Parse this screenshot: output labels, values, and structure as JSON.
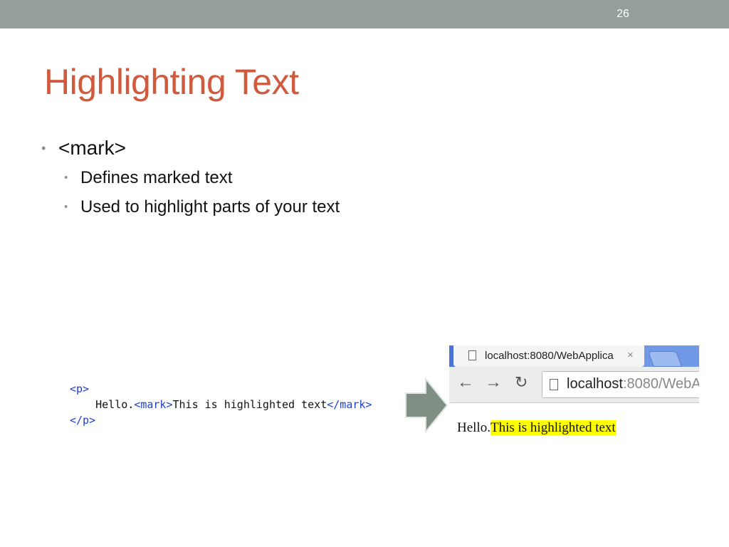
{
  "slide": {
    "number": "26",
    "title": "Highlighting Text"
  },
  "bullets": {
    "main": "<mark>",
    "sub": [
      "Defines marked text",
      "Used to highlight parts of your text"
    ]
  },
  "code": {
    "open_p": "<p>",
    "hello": "Hello.",
    "open_mark": "<mark>",
    "highlighted": "This is highlighted text",
    "close_mark": "</mark>",
    "close_p": "</p>"
  },
  "browser": {
    "tab_title": "localhost:8080/WebApplica",
    "close_glyph": "×",
    "url_host": "localhost",
    "url_rest": ":8080/WebA",
    "rendered_plain": "Hello.",
    "rendered_highlight": "This is highlighted text"
  },
  "colors": {
    "topbar": "#939f98",
    "title": "#d05a3d",
    "code_tag": "#1d3fd0",
    "highlight": "#ffff00",
    "arrow": "#7f8f84"
  }
}
